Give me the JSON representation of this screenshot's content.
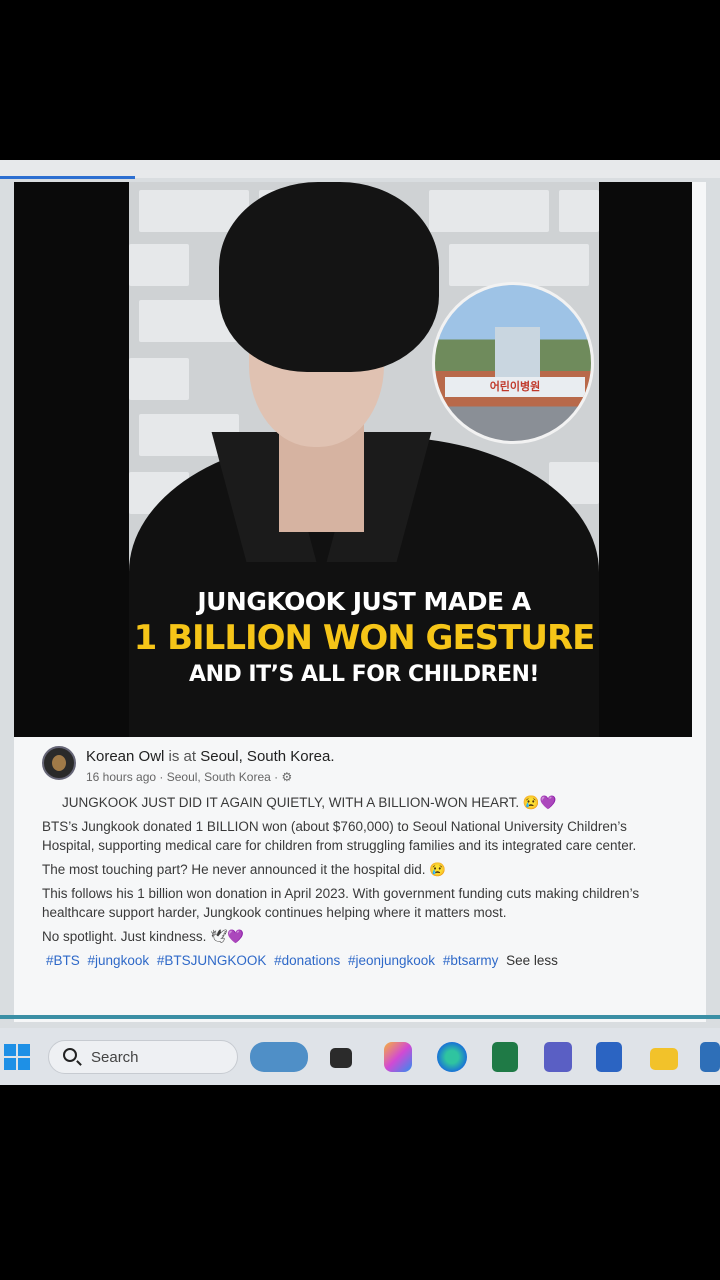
{
  "headline": {
    "line1": "JUNGKOOK JUST MADE A",
    "line2": "1 BILLION WON GESTURE",
    "line3": "AND IT’S ALL FOR CHILDREN!"
  },
  "hospital_sign": "어린이병원",
  "post": {
    "author": "Korean Owl",
    "is_at": "is at",
    "location": "Seoul, South Korea.",
    "time": "16 hours ago · Seoul, South Korea ·",
    "lead": "JUNGKOOK JUST DID IT AGAIN QUIETLY, WITH A BILLION-WON HEART. 😢💜",
    "p1": "BTS’s Jungkook donated 1 BILLION won (about $760,000) to Seoul National University Children’s Hospital, supporting medical care for children from struggling families and its integrated care center.",
    "p2": "The most touching part? He never announced it the hospital did. 😢",
    "p3": "This follows his 1 billion won donation in April 2023. With government funding cuts making children’s healthcare support harder, Jungkook continues helping where it matters most.",
    "p4": "No spotlight. Just kindness. 🕊💜",
    "hashtags": [
      "#BTS",
      "#jungkook",
      "#BTSJUNGKOOK",
      "#donations",
      "#jeonjungkook",
      "#btsarmy"
    ],
    "see_less": "See less"
  },
  "taskbar": {
    "search_label": "Search"
  }
}
